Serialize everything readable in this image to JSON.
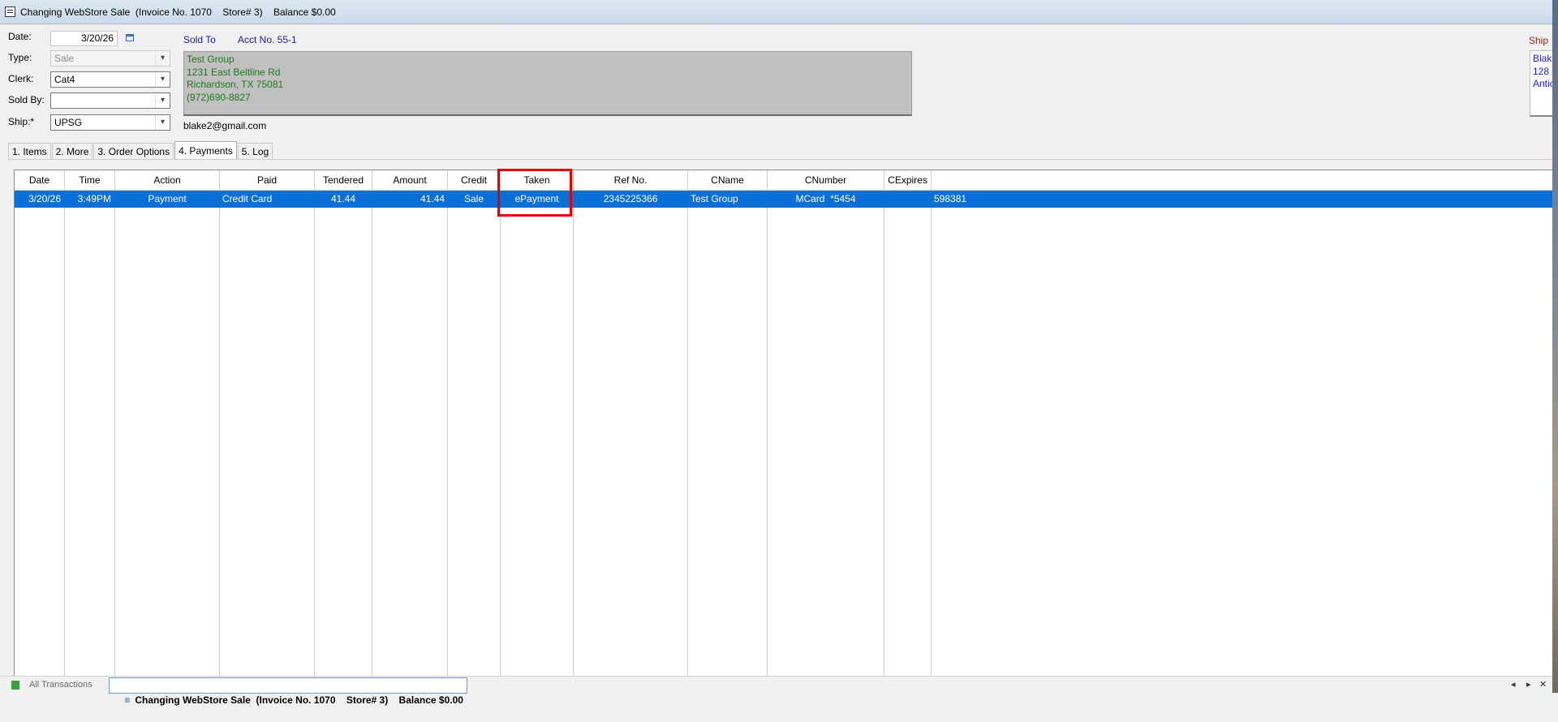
{
  "window": {
    "title": "Changing WebStore Sale  (Invoice No. 1070    Store# 3)    Balance $0.00"
  },
  "header": {
    "date_label": "Date:",
    "date_value": "3/20/26",
    "type_label": "Type:",
    "type_value": "Sale",
    "clerk_label": "Clerk:",
    "clerk_value": "Cat4",
    "soldby_label": "Sold By:",
    "soldby_value": "",
    "ship_label": "Ship:*",
    "ship_value": "UPSG"
  },
  "sold_to": {
    "label": "Sold To",
    "acct": "Acct No. 55-1",
    "lines": [
      "Test Group",
      "1231 East Beltline Rd",
      "Richardson, TX 75081",
      "(972)690-8827"
    ],
    "email": "blake2@gmail.com"
  },
  "ship_to": {
    "label": "Ship",
    "lines": [
      "Blak",
      "128",
      "Antic"
    ]
  },
  "tabs": [
    {
      "label": "1. Items"
    },
    {
      "label": "2. More"
    },
    {
      "label": "3. Order Options"
    },
    {
      "label": "4. Payments",
      "active": true
    },
    {
      "label": "5. Log"
    }
  ],
  "payments_grid": {
    "columns": [
      "Date",
      "Time",
      "Action",
      "Paid",
      "Tendered",
      "Amount",
      "Credit",
      "Taken",
      "Ref No.",
      "CName",
      "CNumber",
      "CExpires",
      ""
    ],
    "rows": [
      [
        "3/20/26",
        "3:49PM",
        "Payment",
        "Credit Card",
        "41.44",
        "41.44",
        "Sale",
        "ePayment",
        "2345225366",
        "Test Group",
        "MCard  *5454",
        "",
        "598381"
      ]
    ],
    "selected_row_color": "#0a6fd6",
    "highlighted_column": "Taken",
    "highlight_color": "#e00000"
  },
  "bottom_bar": {
    "all_transactions": "All Transactions",
    "active_tab": "Changing WebStore Sale  (Invoice No. 1070    Store# 3)    Balance $0.00",
    "nav": [
      "◂",
      "▸",
      "✕"
    ]
  }
}
